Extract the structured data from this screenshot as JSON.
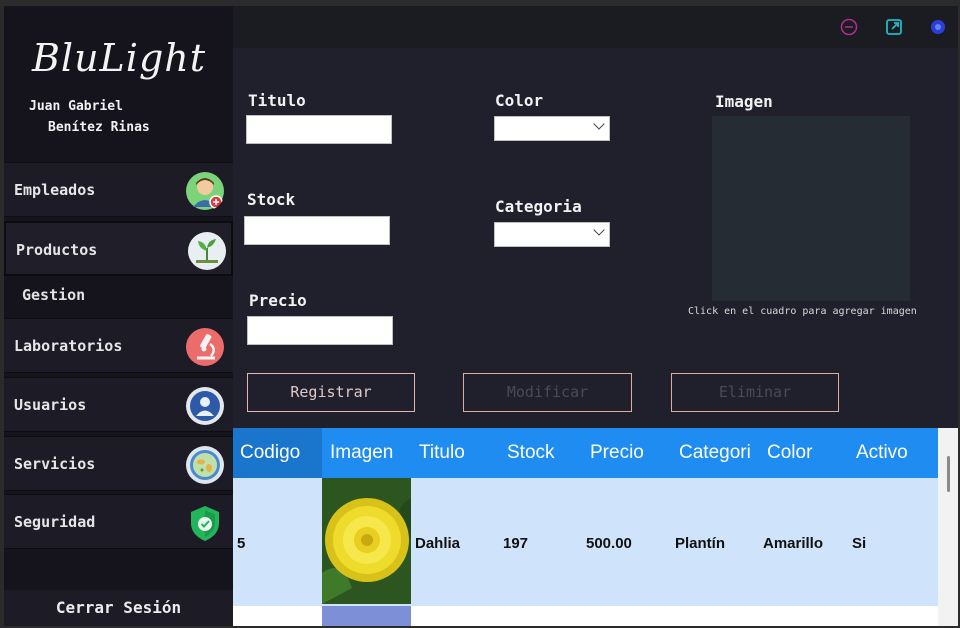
{
  "app": {
    "logo": "BluLight"
  },
  "user": {
    "first_line": "Juan Gabriel",
    "second_line": "Benítez Rinas"
  },
  "sidebar": {
    "items": [
      {
        "label": "Empleados",
        "icon": "employee-icon"
      },
      {
        "label": "Productos",
        "icon": "plant-icon"
      },
      {
        "label": "Laboratorios",
        "icon": "microscope-icon"
      },
      {
        "label": "Usuarios",
        "icon": "user-icon"
      },
      {
        "label": "Servicios",
        "icon": "petri-dish-icon"
      },
      {
        "label": "Seguridad",
        "icon": "shield-icon"
      }
    ],
    "section": "Gestion",
    "logout": "Cerrar Sesión"
  },
  "form": {
    "titulo_label": "Titulo",
    "stock_label": "Stock",
    "precio_label": "Precio",
    "color_label": "Color",
    "categoria_label": "Categoria",
    "imagen_label": "Imagen",
    "image_hint": "Click en el cuadro para agregar imagen",
    "titulo_value": "",
    "stock_value": "",
    "precio_value": "",
    "color_value": "",
    "categoria_value": ""
  },
  "buttons": {
    "registrar": "Registrar",
    "modificar": "Modificar",
    "eliminar": "Eliminar"
  },
  "table": {
    "headers": [
      "Codigo",
      "Imagen",
      "Titulo",
      "Stock",
      "Precio",
      "Categori",
      "Color",
      "Activo"
    ],
    "rows": [
      {
        "codigo": "5",
        "titulo": "Dahlia",
        "stock": "197",
        "precio": "500.00",
        "categoria": "Plantín",
        "color": "Amarillo",
        "activo": "Si"
      }
    ]
  },
  "colors": {
    "accent": "#1e8cf0",
    "row_selected": "#cfe4fb",
    "button_border": "#e6b6ae",
    "background": "#20202c"
  }
}
